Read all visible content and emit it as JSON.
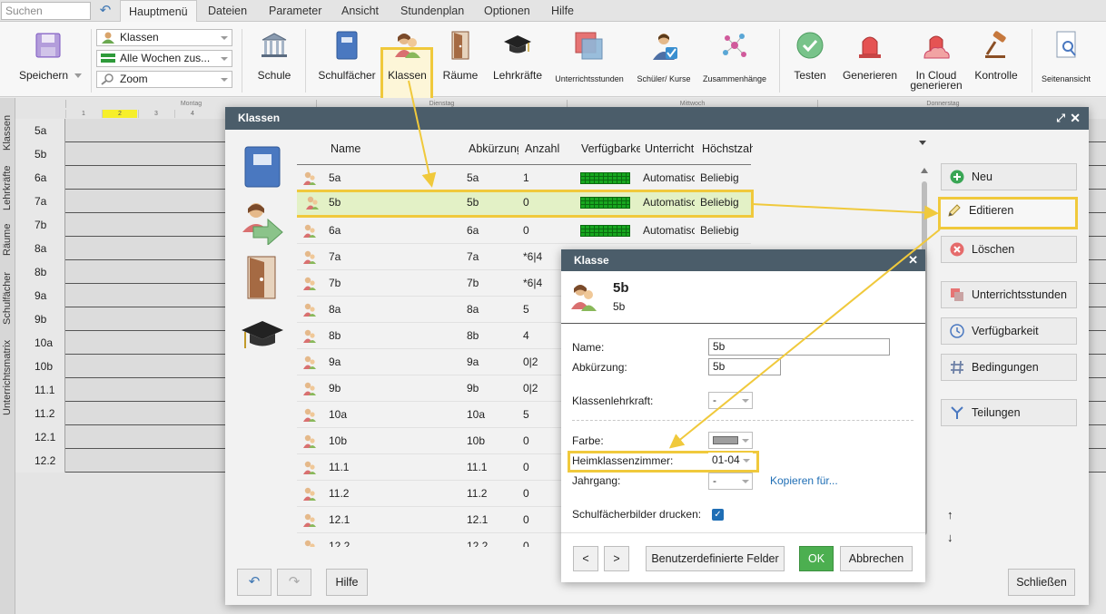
{
  "menubar": {
    "search_placeholder": "Suchen",
    "tabs": [
      "Hauptmenü",
      "Dateien",
      "Parameter",
      "Ansicht",
      "Stundenplan",
      "Optionen",
      "Hilfe"
    ]
  },
  "ribbon": {
    "save": "Speichern",
    "combo_klassen": "Klassen",
    "combo_weeks": "Alle Wochen zus...",
    "combo_zoom": "Zoom",
    "schule": "Schule",
    "schulfaecher": "Schulfächer",
    "klassen": "Klassen",
    "raeume": "Räume",
    "lehrkraefte": "Lehrkräfte",
    "unterrichtsstunden": "Unterrichtsstunden",
    "schueler_kurse": "Schüler/ Kurse",
    "zusammenhaenge": "Zusammenhänge",
    "testen": "Testen",
    "generieren": "Generieren",
    "in_cloud_1": "In Cloud",
    "in_cloud_2": "generieren",
    "kontrolle": "Kontrolle",
    "seitenansicht": "Seitenansicht"
  },
  "vtabs": [
    "Klassen",
    "Lehrkräfte",
    "Räume",
    "Schulfächer",
    "Unterrichtsmatrix"
  ],
  "grid": {
    "days": [
      "Montag",
      "Dienstag",
      "Mittwoch",
      "Donnerstag"
    ],
    "periods": [
      "1",
      "2",
      "3",
      "4"
    ],
    "highlighted_period": "2",
    "rows": [
      "5a",
      "5b",
      "6a",
      "7a",
      "7b",
      "8a",
      "8b",
      "9a",
      "9b",
      "10a",
      "10b",
      "11.1",
      "11.2",
      "12.1",
      "12.2"
    ]
  },
  "klassen_dialog": {
    "title": "Klassen",
    "columns": [
      "Name",
      "Abkürzung",
      "Anzahl",
      "Verfügbarkeit",
      "Unterricht",
      "Höchstzahl"
    ],
    "rows": [
      {
        "name": "5a",
        "abbr": "5a",
        "count": "1",
        "unterricht": "Automatisch",
        "hoechst": "Beliebig"
      },
      {
        "name": "5b",
        "abbr": "5b",
        "count": "0",
        "unterricht": "Automatisch",
        "hoechst": "Beliebig"
      },
      {
        "name": "6a",
        "abbr": "6a",
        "count": "0",
        "unterricht": "Automatisch",
        "hoechst": "Beliebig"
      },
      {
        "name": "7a",
        "abbr": "7a",
        "count": "*6|4",
        "unterricht": "",
        "hoechst": ""
      },
      {
        "name": "7b",
        "abbr": "7b",
        "count": "*6|4",
        "unterricht": "",
        "hoechst": ""
      },
      {
        "name": "8a",
        "abbr": "8a",
        "count": "5",
        "unterricht": "",
        "hoechst": ""
      },
      {
        "name": "8b",
        "abbr": "8b",
        "count": "4",
        "unterricht": "",
        "hoechst": ""
      },
      {
        "name": "9a",
        "abbr": "9a",
        "count": "0|2",
        "unterricht": "",
        "hoechst": ""
      },
      {
        "name": "9b",
        "abbr": "9b",
        "count": "0|2",
        "unterricht": "",
        "hoechst": ""
      },
      {
        "name": "10a",
        "abbr": "10a",
        "count": "5",
        "unterricht": "",
        "hoechst": ""
      },
      {
        "name": "10b",
        "abbr": "10b",
        "count": "0",
        "unterricht": "",
        "hoechst": ""
      },
      {
        "name": "11.1",
        "abbr": "11.1",
        "count": "0",
        "unterricht": "",
        "hoechst": ""
      },
      {
        "name": "11.2",
        "abbr": "11.2",
        "count": "0",
        "unterricht": "",
        "hoechst": ""
      },
      {
        "name": "12.1",
        "abbr": "12.1",
        "count": "0",
        "unterricht": "",
        "hoechst": ""
      },
      {
        "name": "12.2",
        "abbr": "12.2",
        "count": "0",
        "unterricht": "",
        "hoechst": ""
      }
    ],
    "selected_row": "5b",
    "actions": {
      "neu": "Neu",
      "editieren": "Editieren",
      "loeschen": "Löschen",
      "unterrichtsstunden": "Unterrichtsstunden",
      "verfuegbarkeit": "Verfügbarkeit",
      "bedingungen": "Bedingungen",
      "teilungen": "Teilungen"
    },
    "arrow_up": "↑",
    "arrow_down": "↓",
    "hilfe": "Hilfe",
    "schliessen": "Schließen"
  },
  "klasse_dialog": {
    "title": "Klasse",
    "heading": "5b",
    "subheading": "5b",
    "name_label": "Name:",
    "name_value": "5b",
    "abk_label": "Abkürzung:",
    "abk_value": "5b",
    "lehrkraft_label": "Klassenlehrkraft:",
    "lehrkraft_value": "-",
    "farbe_label": "Farbe:",
    "heim_label": "Heimklassenzimmer:",
    "heim_value": "01-04",
    "jahrgang_label": "Jahrgang:",
    "jahrgang_value": "-",
    "kopieren": "Kopieren für...",
    "drucken_label": "Schulfächerbilder drucken:",
    "prev": "<",
    "next": ">",
    "custom_fields": "Benutzerdefinierte Felder",
    "ok": "OK",
    "cancel": "Abbrechen"
  },
  "colors": {
    "accent_highlight": "#f0c93c",
    "dialog_header": "#4b5d6a",
    "ok_green": "#4caf50",
    "link_blue": "#1f6eb5"
  }
}
